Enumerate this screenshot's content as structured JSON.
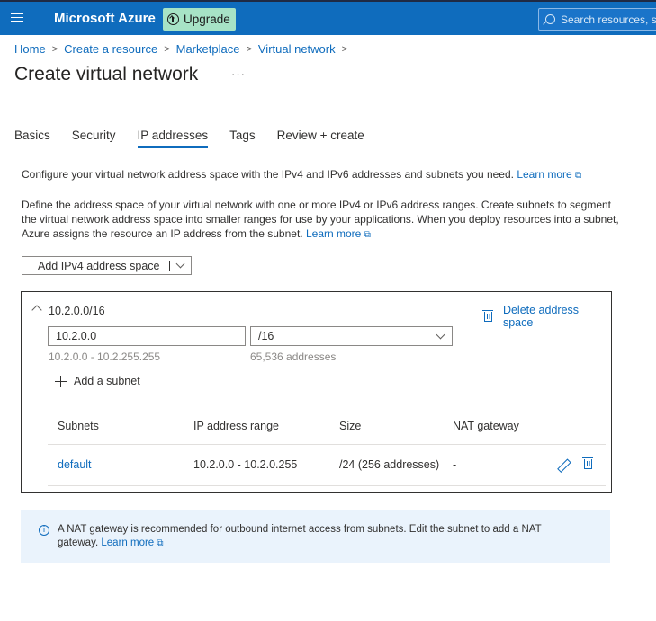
{
  "header": {
    "brand": "Microsoft Azure",
    "upgrade_label": "Upgrade",
    "search_placeholder": "Search resources, se"
  },
  "breadcrumb": [
    "Home",
    "Create a resource",
    "Marketplace",
    "Virtual network"
  ],
  "page": {
    "title": "Create virtual network",
    "more": "···"
  },
  "tabs": [
    {
      "label": "Basics",
      "active": false
    },
    {
      "label": "Security",
      "active": false
    },
    {
      "label": "IP addresses",
      "active": true
    },
    {
      "label": "Tags",
      "active": false
    },
    {
      "label": "Review + create",
      "active": false
    }
  ],
  "intro": {
    "text": "Configure your virtual network address space with the IPv4 and IPv6 addresses and subnets you need.",
    "link": "Learn more"
  },
  "description": {
    "text": "Define the address space of your virtual network with one or more IPv4 or IPv6 address ranges. Create subnets to segment the virtual network address space into smaller ranges for use by your applications. When you deploy resources into a subnet, Azure assigns the resource an IP address from the subnet.",
    "link": "Learn more"
  },
  "add_space_button": "Add IPv4 address space",
  "address_space": {
    "title": "10.2.0.0/16",
    "delete_label": "Delete address space",
    "ip_value": "10.2.0.0",
    "prefix_value": "/16",
    "range_hint": "10.2.0.0 - 10.2.255.255",
    "count_hint": "65,536 addresses",
    "add_subnet": "Add a subnet",
    "columns": [
      "Subnets",
      "IP address range",
      "Size",
      "NAT gateway"
    ],
    "rows": [
      {
        "name": "default",
        "range": "10.2.0.0 - 10.2.0.255",
        "size": "/24 (256 addresses)",
        "nat": "-"
      }
    ]
  },
  "info_bar": {
    "text": "A NAT gateway is recommended for outbound internet access from subnets. Edit the subnet to add a NAT gateway.",
    "link": "Learn more"
  },
  "colors": {
    "accent": "#0f6cbd",
    "upgrade_bg": "#a7e3c6",
    "info_bg": "#eaf3fc"
  },
  "icons": [
    "hamburger-icon",
    "upgrade-icon",
    "search-icon",
    "chevron-down-icon",
    "chevron-up-icon",
    "trash-icon",
    "plus-icon",
    "edit-icon",
    "info-icon",
    "external-link-icon"
  ]
}
